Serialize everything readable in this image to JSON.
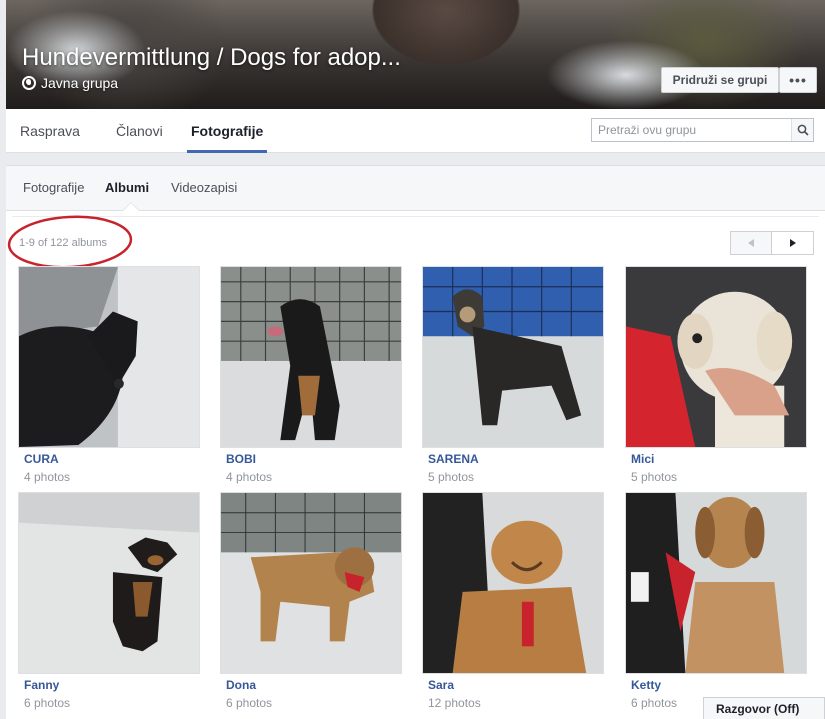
{
  "cover": {
    "title": "Hundevermittlung / Dogs for adop...",
    "privacy": "Javna grupa",
    "join_label": "Pridruži se grupi",
    "more_label": "•••"
  },
  "group_nav": {
    "tabs": [
      {
        "label": "Rasprava",
        "active": false
      },
      {
        "label": "Članovi",
        "active": false
      },
      {
        "label": "Fotografije",
        "active": true
      }
    ],
    "search_placeholder": "Pretraži ovu grupu"
  },
  "photos": {
    "subtabs": [
      {
        "label": "Fotografije",
        "active": false
      },
      {
        "label": "Albumi",
        "active": true
      },
      {
        "label": "Videozapisi",
        "active": false
      }
    ],
    "count": "1-9 of 122 albums",
    "albums": [
      {
        "name": "CURA",
        "count": "4 photos"
      },
      {
        "name": "BOBI",
        "count": "4 photos"
      },
      {
        "name": "SARENA",
        "count": "5 photos"
      },
      {
        "name": "Mici",
        "count": "5 photos"
      },
      {
        "name": "Fanny",
        "count": "6 photos"
      },
      {
        "name": "Dona",
        "count": "6 photos"
      },
      {
        "name": "Sara",
        "count": "12 photos"
      },
      {
        "name": "Ketty",
        "count": "6 photos"
      }
    ]
  },
  "chat": {
    "label": "Razgovor (Off)"
  },
  "colors": {
    "link": "#365899",
    "accent": "#4267b2",
    "annotation": "#c8232c"
  }
}
